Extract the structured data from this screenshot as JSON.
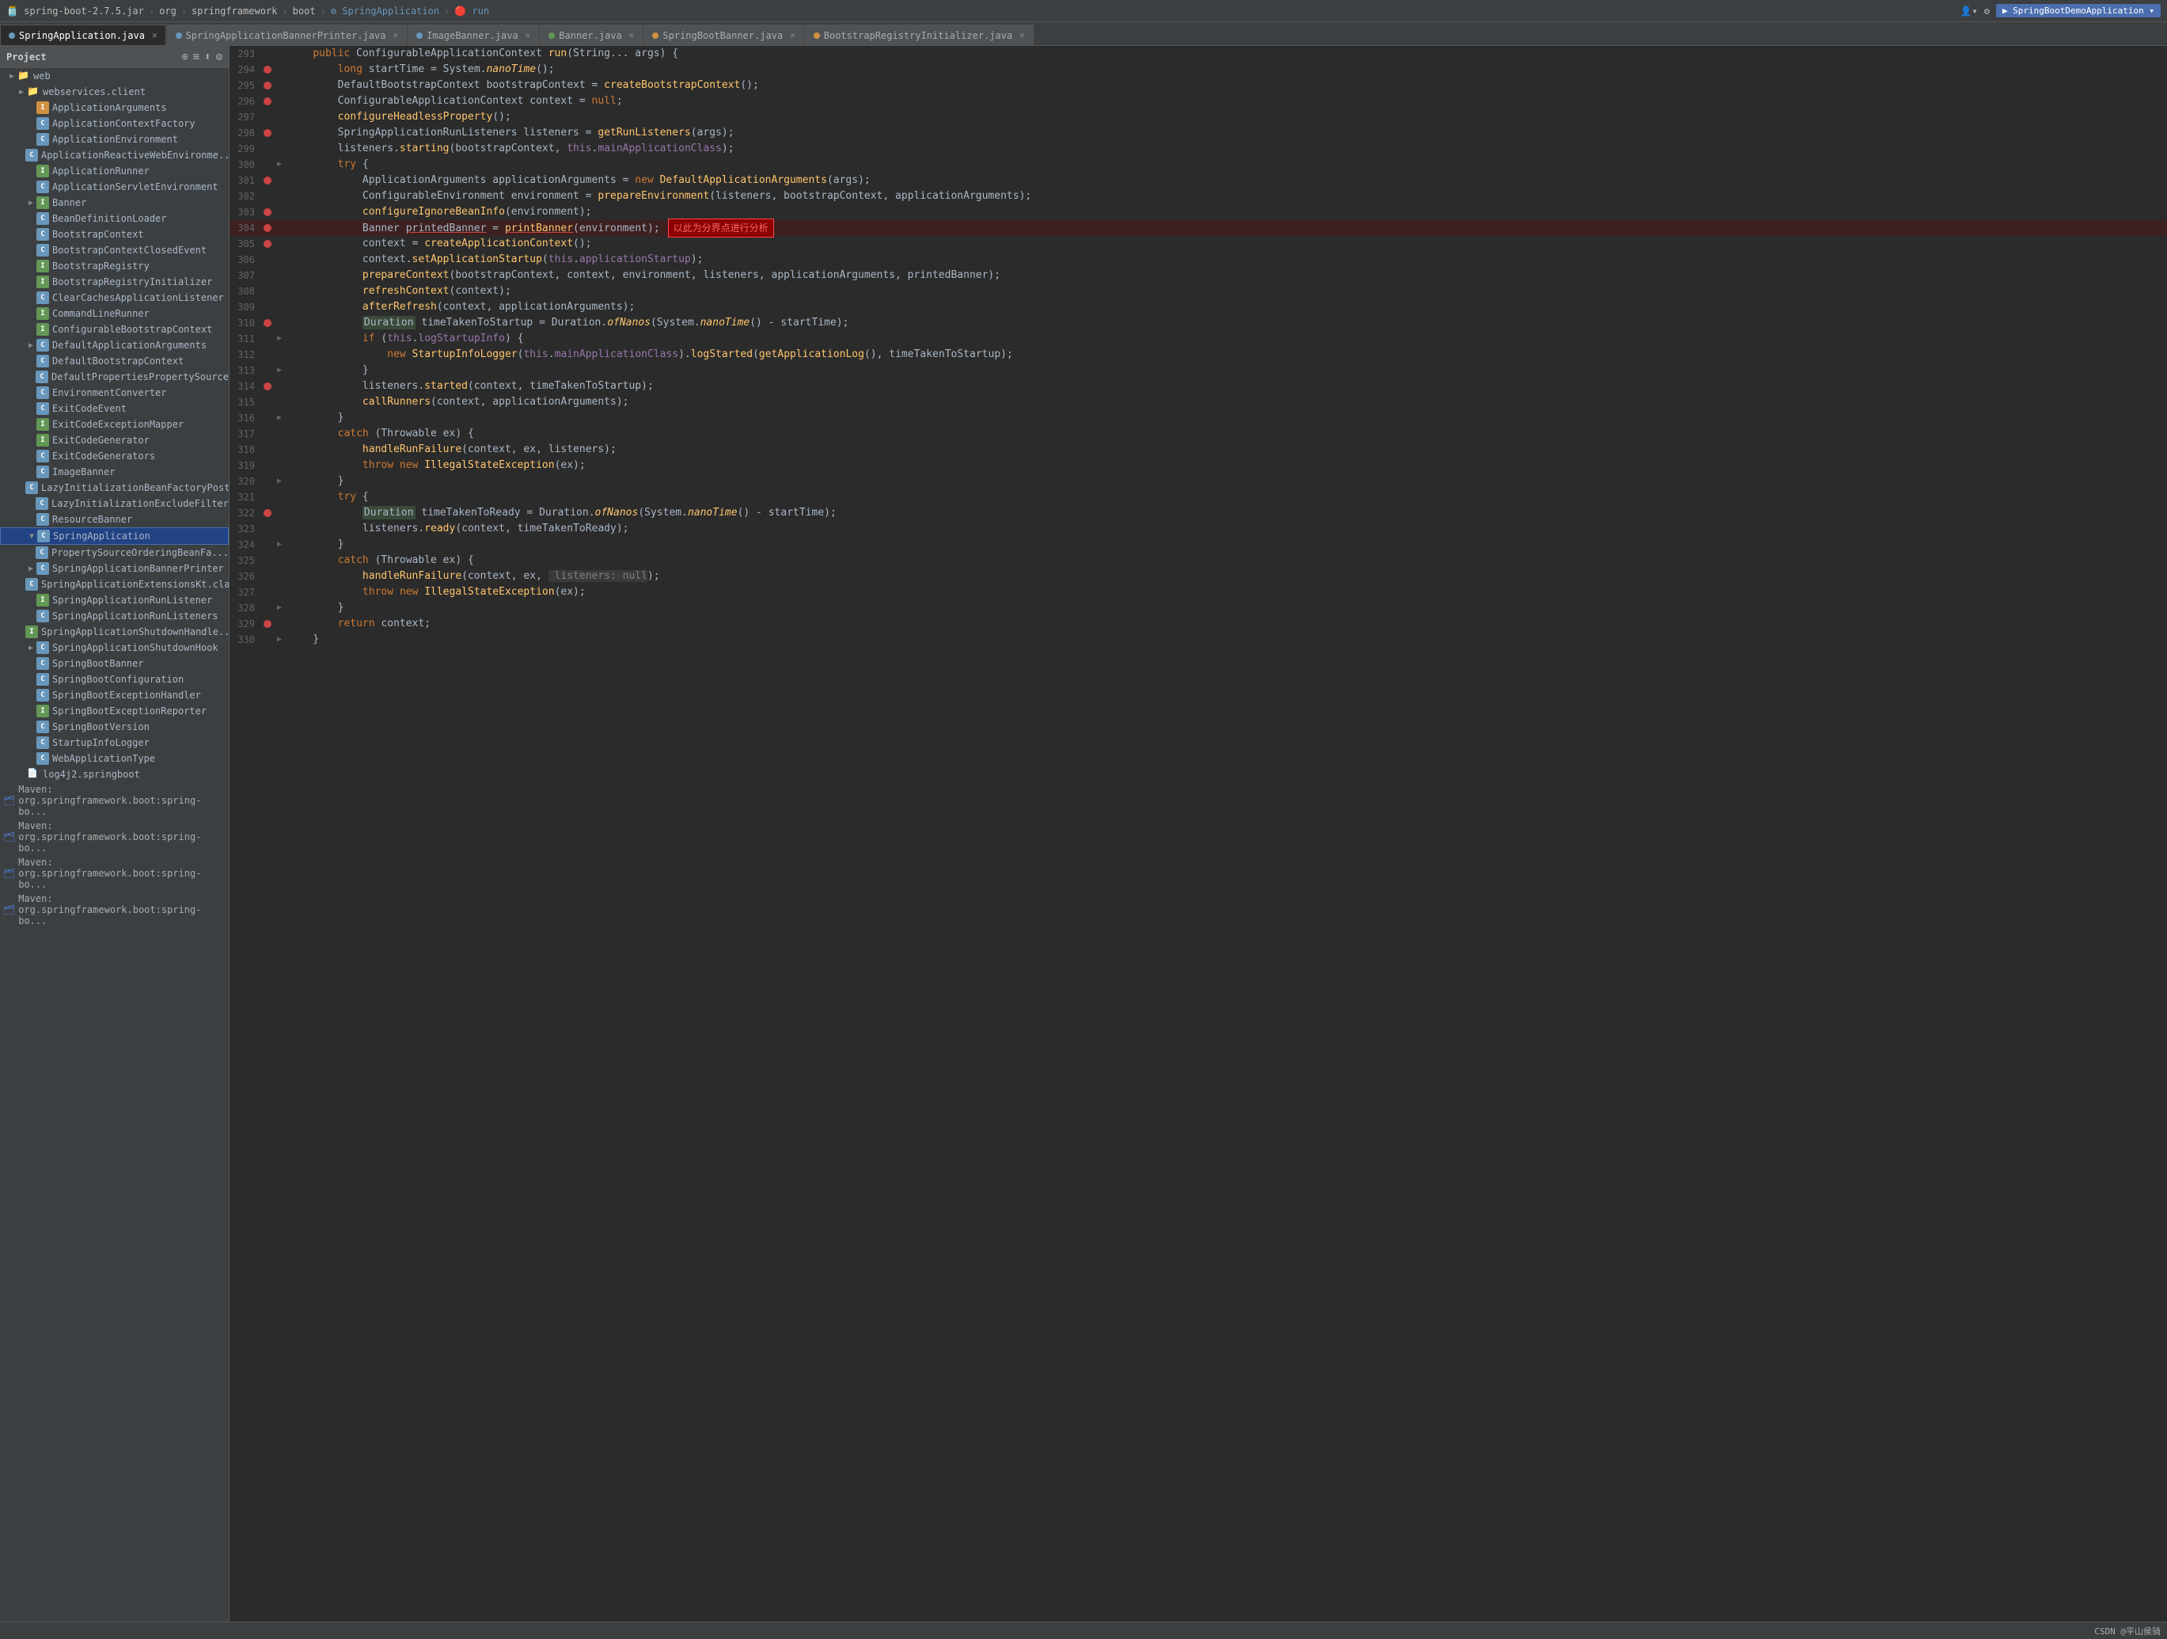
{
  "topbar": {
    "items": [
      {
        "label": "spring-boot-2.7.5.jar",
        "active": false
      },
      {
        "label": "org",
        "active": false
      },
      {
        "label": "springframework",
        "active": false
      },
      {
        "label": "boot",
        "active": false
      },
      {
        "label": "SpringApplication",
        "active": false
      },
      {
        "label": "run",
        "active": true
      }
    ],
    "right": {
      "user_icon": "👤",
      "app_label": "SpringBootDemoApplication"
    }
  },
  "tabs": [
    {
      "label": "SpringApplication.java",
      "color": "blue",
      "active": true
    },
    {
      "label": "SpringApplicationBannerPrinter.java",
      "color": "blue",
      "active": false
    },
    {
      "label": "ImageBanner.java",
      "color": "blue",
      "active": false
    },
    {
      "label": "Banner.java",
      "color": "green",
      "active": false
    },
    {
      "label": "SpringBootBanner.java",
      "color": "orange",
      "active": false
    },
    {
      "label": "BootstrapRegistryInitializer.java",
      "color": "orange",
      "active": false
    }
  ],
  "sidebar": {
    "title": "Project",
    "tree_items": [
      {
        "label": "web",
        "indent": 2,
        "type": "folder",
        "arrow": "▶"
      },
      {
        "label": "webservices.client",
        "indent": 3,
        "type": "folder",
        "arrow": "▶"
      },
      {
        "label": "ApplicationArguments",
        "indent": 4,
        "type": "c-orange",
        "arrow": ""
      },
      {
        "label": "ApplicationContextFactory",
        "indent": 4,
        "type": "c-blue",
        "arrow": ""
      },
      {
        "label": "ApplicationEnvironment",
        "indent": 4,
        "type": "c-blue",
        "arrow": ""
      },
      {
        "label": "ApplicationReactiveWebEnvironme...",
        "indent": 4,
        "type": "c-blue",
        "arrow": ""
      },
      {
        "label": "ApplicationRunner",
        "indent": 4,
        "type": "c-green",
        "arrow": ""
      },
      {
        "label": "ApplicationServletEnvironment",
        "indent": 4,
        "type": "c-blue",
        "arrow": ""
      },
      {
        "label": "Banner",
        "indent": 4,
        "type": "c-green",
        "arrow": "▶"
      },
      {
        "label": "BeanDefinitionLoader",
        "indent": 4,
        "type": "c-blue",
        "arrow": ""
      },
      {
        "label": "BootstrapContext",
        "indent": 4,
        "type": "c-green",
        "arrow": ""
      },
      {
        "label": "BootstrapContextClosedEvent",
        "indent": 4,
        "type": "c-blue",
        "arrow": ""
      },
      {
        "label": "BootstrapRegistry",
        "indent": 4,
        "type": "c-green",
        "arrow": ""
      },
      {
        "label": "BootstrapRegistryInitializer",
        "indent": 4,
        "type": "c-green",
        "arrow": ""
      },
      {
        "label": "ClearCachesApplicationListener",
        "indent": 4,
        "type": "c-blue",
        "arrow": ""
      },
      {
        "label": "CommandLineRunner",
        "indent": 4,
        "type": "c-green",
        "arrow": ""
      },
      {
        "label": "ConfigurableBootstrapContext",
        "indent": 4,
        "type": "c-green",
        "arrow": ""
      },
      {
        "label": "DefaultApplicationArguments",
        "indent": 4,
        "type": "c-blue",
        "arrow": "▶"
      },
      {
        "label": "DefaultBootstrapContext",
        "indent": 4,
        "type": "c-blue",
        "arrow": ""
      },
      {
        "label": "DefaultPropertiesPropertySource",
        "indent": 4,
        "type": "c-blue",
        "arrow": ""
      },
      {
        "label": "EnvironmentConverter",
        "indent": 4,
        "type": "c-blue",
        "arrow": ""
      },
      {
        "label": "ExitCodeEvent",
        "indent": 4,
        "type": "c-blue",
        "arrow": ""
      },
      {
        "label": "ExitCodeExceptionMapper",
        "indent": 4,
        "type": "c-green",
        "arrow": ""
      },
      {
        "label": "ExitCodeGenerator",
        "indent": 4,
        "type": "c-green",
        "arrow": ""
      },
      {
        "label": "ExitCodeGenerators",
        "indent": 4,
        "type": "c-blue",
        "arrow": ""
      },
      {
        "label": "ImageBanner",
        "indent": 4,
        "type": "c-blue",
        "arrow": ""
      },
      {
        "label": "LazyInitializationBeanFactoryPostPr...",
        "indent": 4,
        "type": "c-blue",
        "arrow": ""
      },
      {
        "label": "LazyInitializationExcludeFilter",
        "indent": 4,
        "type": "c-blue",
        "arrow": ""
      },
      {
        "label": "ResourceBanner",
        "indent": 4,
        "type": "c-blue",
        "arrow": ""
      },
      {
        "label": "SpringApplication",
        "indent": 4,
        "type": "c-blue",
        "arrow": "▼",
        "selected": true
      },
      {
        "label": "PropertySourceOrderingBeanFa...",
        "indent": 5,
        "type": "c-blue",
        "arrow": ""
      },
      {
        "label": "SpringApplicationBannerPrinter",
        "indent": 4,
        "type": "c-blue",
        "arrow": "▶"
      },
      {
        "label": "SpringApplicationExtensionsKt.clas...",
        "indent": 4,
        "type": "c-blue",
        "arrow": ""
      },
      {
        "label": "SpringApplicationRunListener",
        "indent": 4,
        "type": "c-green",
        "arrow": ""
      },
      {
        "label": "SpringApplicationRunListeners",
        "indent": 4,
        "type": "c-blue",
        "arrow": ""
      },
      {
        "label": "SpringApplicationShutdownHandle...",
        "indent": 4,
        "type": "c-green",
        "arrow": ""
      },
      {
        "label": "SpringApplicationShutdownHook",
        "indent": 4,
        "type": "c-blue",
        "arrow": "▶"
      },
      {
        "label": "SpringBootBanner",
        "indent": 4,
        "type": "c-blue",
        "arrow": ""
      },
      {
        "label": "SpringBootConfiguration",
        "indent": 4,
        "type": "c-blue",
        "arrow": ""
      },
      {
        "label": "SpringBootExceptionHandler",
        "indent": 4,
        "type": "c-blue",
        "arrow": ""
      },
      {
        "label": "SpringBootExceptionReporter",
        "indent": 4,
        "type": "c-green",
        "arrow": ""
      },
      {
        "label": "SpringBootVersion",
        "indent": 4,
        "type": "c-blue",
        "arrow": ""
      },
      {
        "label": "StartupInfoLogger",
        "indent": 4,
        "type": "c-blue",
        "arrow": ""
      },
      {
        "label": "WebApplicationType",
        "indent": 4,
        "type": "c-blue",
        "arrow": ""
      },
      {
        "label": "log4j2.springboot",
        "indent": 3,
        "type": "file",
        "arrow": ""
      }
    ],
    "maven_items": [
      "Maven: org.springframework.boot:spring-bo...",
      "Maven: org.springframework.boot:spring-bo...",
      "Maven: org.springframework.boot:spring-bo...",
      "Maven: org.springframework.boot:spring-bo..."
    ]
  },
  "code": {
    "lines": [
      {
        "num": 293,
        "breakpoint": false,
        "fold": false,
        "content": "    public ConfigurableApplicationContext run(String... args) {",
        "highlight": false
      },
      {
        "num": 294,
        "breakpoint": true,
        "fold": false,
        "content": "        long startTime = System.nanoTime();",
        "highlight": false
      },
      {
        "num": 295,
        "breakpoint": true,
        "fold": false,
        "content": "        DefaultBootstrapContext bootstrapContext = createBootstrapContext();",
        "highlight": false
      },
      {
        "num": 296,
        "breakpoint": true,
        "fold": false,
        "content": "        ConfigurableApplicationContext context = null;",
        "highlight": false
      },
      {
        "num": 297,
        "breakpoint": false,
        "fold": false,
        "content": "        configureHeadlessProperty();",
        "highlight": false
      },
      {
        "num": 298,
        "breakpoint": true,
        "fold": false,
        "content": "        SpringApplicationRunListeners listeners = getRunListeners(args);",
        "highlight": false
      },
      {
        "num": 299,
        "breakpoint": false,
        "fold": false,
        "content": "        listeners.starting(bootstrapContext, this.mainApplicationClass);",
        "highlight": false
      },
      {
        "num": 300,
        "breakpoint": false,
        "fold": true,
        "content": "        try {",
        "highlight": false
      },
      {
        "num": 301,
        "breakpoint": true,
        "fold": false,
        "content": "            ApplicationArguments applicationArguments = new DefaultApplicationArguments(args);",
        "highlight": false
      },
      {
        "num": 302,
        "breakpoint": false,
        "fold": false,
        "content": "            ConfigurableEnvironment environment = prepareEnvironment(listeners, bootstrapContext, applicationArguments);",
        "highlight": false
      },
      {
        "num": 303,
        "breakpoint": true,
        "fold": false,
        "content": "            configureIgnoreBeanInfo(environment);",
        "highlight": false
      },
      {
        "num": 304,
        "breakpoint": true,
        "fold": false,
        "content": "            Banner printedBanner = printBanner(environment);",
        "highlight": true,
        "annotation": "以此为分界点进行分析"
      },
      {
        "num": 305,
        "breakpoint": true,
        "fold": false,
        "content": "            context = createApplicationContext();",
        "highlight": false
      },
      {
        "num": 306,
        "breakpoint": false,
        "fold": false,
        "content": "            context.setApplicationStartup(this.applicationStartup);",
        "highlight": false
      },
      {
        "num": 307,
        "breakpoint": false,
        "fold": false,
        "content": "            prepareContext(bootstrapContext, context, environment, listeners, applicationArguments, printedBanner);",
        "highlight": false
      },
      {
        "num": 308,
        "breakpoint": false,
        "fold": false,
        "content": "            refreshContext(context);",
        "highlight": false
      },
      {
        "num": 309,
        "breakpoint": false,
        "fold": false,
        "content": "            afterRefresh(context, applicationArguments);",
        "highlight": false
      },
      {
        "num": 310,
        "breakpoint": true,
        "fold": false,
        "content": "            Duration timeTakenToStartup = Duration.ofNanos(System.nanoTime() - startTime);",
        "highlight": false
      },
      {
        "num": 311,
        "breakpoint": false,
        "fold": true,
        "content": "            if (this.logStartupInfo) {",
        "highlight": false
      },
      {
        "num": 312,
        "breakpoint": false,
        "fold": false,
        "content": "                new StartupInfoLogger(this.mainApplicationClass).logStarted(getApplicationLog(), timeTakenToStartup);",
        "highlight": false
      },
      {
        "num": 313,
        "breakpoint": false,
        "fold": true,
        "content": "            }",
        "highlight": false
      },
      {
        "num": 314,
        "breakpoint": true,
        "fold": false,
        "content": "            listeners.started(context, timeTakenToStartup);",
        "highlight": false
      },
      {
        "num": 315,
        "breakpoint": false,
        "fold": false,
        "content": "            callRunners(context, applicationArguments);",
        "highlight": false
      },
      {
        "num": 316,
        "breakpoint": false,
        "fold": true,
        "content": "        }",
        "highlight": false
      },
      {
        "num": 317,
        "breakpoint": false,
        "fold": false,
        "content": "        catch (Throwable ex) {",
        "highlight": false
      },
      {
        "num": 318,
        "breakpoint": false,
        "fold": false,
        "content": "            handleRunFailure(context, ex, listeners);",
        "highlight": false
      },
      {
        "num": 319,
        "breakpoint": false,
        "fold": false,
        "content": "            throw new IllegalStateException(ex);",
        "highlight": false
      },
      {
        "num": 320,
        "breakpoint": false,
        "fold": true,
        "content": "        }",
        "highlight": false
      },
      {
        "num": 321,
        "breakpoint": false,
        "fold": false,
        "content": "        try {",
        "highlight": false
      },
      {
        "num": 322,
        "breakpoint": true,
        "fold": false,
        "content": "            Duration timeTakenToReady = Duration.ofNanos(System.nanoTime() - startTime);",
        "highlight": false
      },
      {
        "num": 323,
        "breakpoint": false,
        "fold": false,
        "content": "            listeners.ready(context, timeTakenToReady);",
        "highlight": false
      },
      {
        "num": 324,
        "breakpoint": false,
        "fold": true,
        "content": "        }",
        "highlight": false
      },
      {
        "num": 325,
        "breakpoint": false,
        "fold": false,
        "content": "        catch (Throwable ex) {",
        "highlight": false
      },
      {
        "num": 326,
        "breakpoint": false,
        "fold": false,
        "content": "            handleRunFailure(context, ex,  listeners: null);",
        "highlight": false
      },
      {
        "num": 327,
        "breakpoint": false,
        "fold": false,
        "content": "            throw new IllegalStateException(ex);",
        "highlight": false
      },
      {
        "num": 328,
        "breakpoint": false,
        "fold": true,
        "content": "        }",
        "highlight": false
      },
      {
        "num": 329,
        "breakpoint": true,
        "fold": false,
        "content": "        return context;",
        "highlight": false
      },
      {
        "num": 330,
        "breakpoint": false,
        "fold": true,
        "content": "    }",
        "highlight": false
      }
    ]
  },
  "statusbar": {
    "left": "",
    "right": "CSDN @平山侯骑"
  }
}
